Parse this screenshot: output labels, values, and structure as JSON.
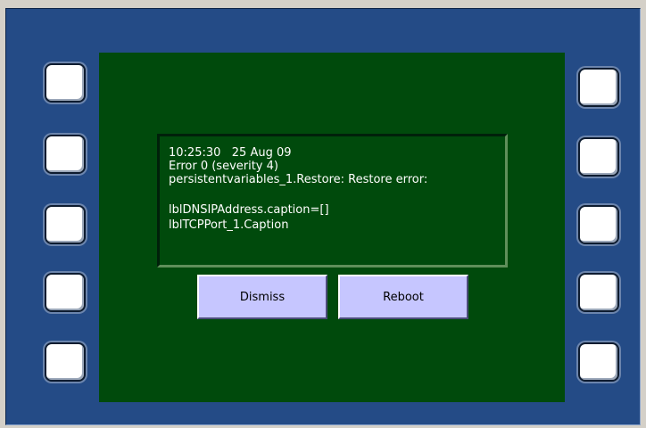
{
  "side_keys": {
    "left": [
      "softkey-left-1",
      "softkey-left-2",
      "softkey-left-3",
      "softkey-left-4",
      "softkey-left-5"
    ],
    "right": [
      "softkey-right-1",
      "softkey-right-2",
      "softkey-right-3",
      "softkey-right-4",
      "softkey-right-5"
    ]
  },
  "error_dialog": {
    "lines": [
      "10:25:30   25 Aug 09",
      "Error 0 (severity 4)",
      "persistentvariables_1.Restore: Restore error:",
      "",
      "lblDNSIPAddress.caption=[]",
      "lblTCPPort_1.Caption"
    ],
    "dismiss_label": "Dismiss",
    "reboot_label": "Reboot"
  },
  "colors": {
    "bezel": "#244b86",
    "screen": "#004a0c",
    "button": "#c6c6ff",
    "text": "#ffffff"
  }
}
